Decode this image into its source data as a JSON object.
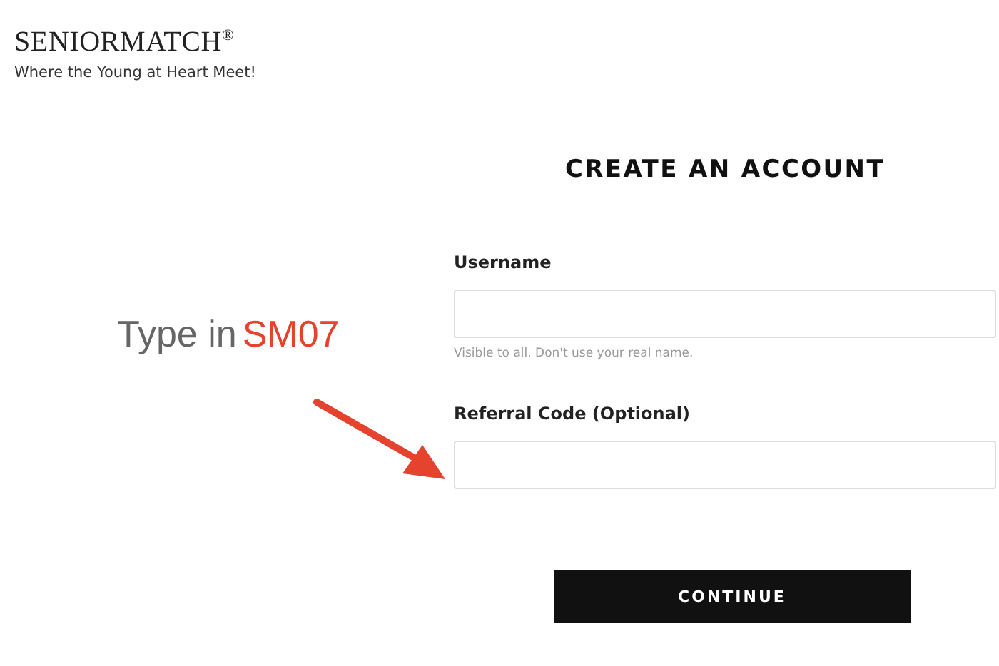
{
  "brand": {
    "name": "SENIORMATCH",
    "mark": "®",
    "tagline": "Where the Young at Heart Meet!"
  },
  "annotation": {
    "prefix": "Type in",
    "code": "SM07"
  },
  "form": {
    "title": "CREATE AN ACCOUNT",
    "fields": [
      {
        "label": "Username",
        "hint": "Visible to all. Don't use your real name."
      },
      {
        "label": "Referral Code (Optional)"
      }
    ],
    "submit": "CONTINUE"
  }
}
